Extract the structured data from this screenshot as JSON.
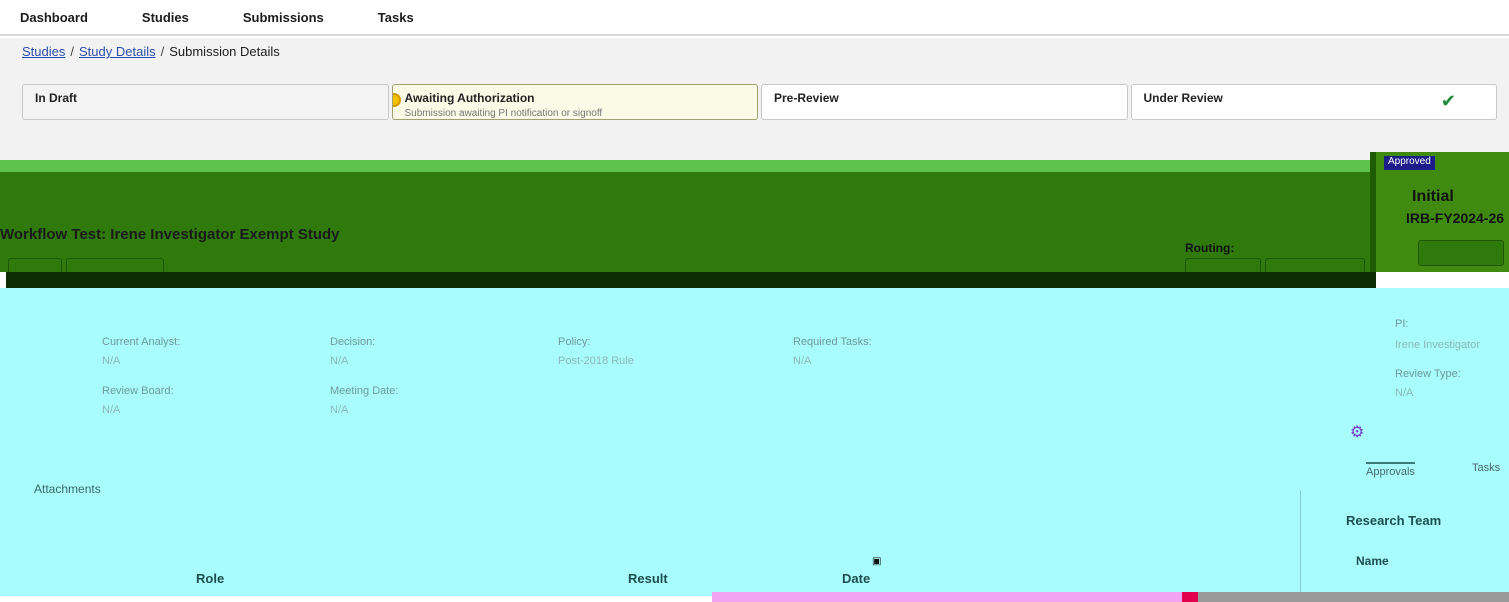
{
  "nav": {
    "items": [
      "Dashboard",
      "Studies",
      "Submissions",
      "Tasks"
    ]
  },
  "breadcrumb": {
    "studies": "Studies",
    "study_details": "Study Details",
    "separator": "/",
    "current": "Submission Details"
  },
  "stepper": {
    "steps": [
      {
        "title": "In Draft",
        "sub": ""
      },
      {
        "title": "Awaiting Authorization",
        "sub": "Submission awaiting PI notification or signoff"
      },
      {
        "title": "Pre-Review",
        "sub": ""
      },
      {
        "title": "Under Review",
        "sub": ""
      }
    ],
    "check_icon": "check-icon"
  },
  "header": {
    "study_title": "Workflow Test: Irene Investigator Exempt Study",
    "routing_label": "Routing:",
    "badge_top": "Approved",
    "submission_type": "Initial",
    "submission_id": "IRB-FY2024-26"
  },
  "details": {
    "current_analyst_label": "Current Analyst:",
    "current_analyst_value": "N/A",
    "decision_label": "Decision:",
    "decision_value": "N/A",
    "policy_label": "Policy:",
    "policy_value": "Post-2018 Rule",
    "required_tasks_label": "Required Tasks:",
    "required_tasks_value": "N/A",
    "review_board_label": "Review Board:",
    "review_board_value": "N/A",
    "meeting_date_label": "Meeting Date:",
    "meeting_date_value": "N/A",
    "pi_label": "PI:",
    "pi_value": "Irene Investigator",
    "review_type_label": "Review Type:",
    "review_type_value": "N/A"
  },
  "tabs": {
    "approvals": "Approvals",
    "tasks": "Tasks"
  },
  "attachments": {
    "label": "Attachments"
  },
  "research_team": {
    "title": "Research Team",
    "name_header": "Name"
  },
  "approvals_table": {
    "headers": [
      "Role",
      "Result",
      "Date"
    ]
  },
  "colors": {
    "header_green": "#2f7a0b",
    "content_cyan": "#a8fcfc",
    "link_blue": "#2a4fa8",
    "check_green": "#1d8a3a"
  }
}
